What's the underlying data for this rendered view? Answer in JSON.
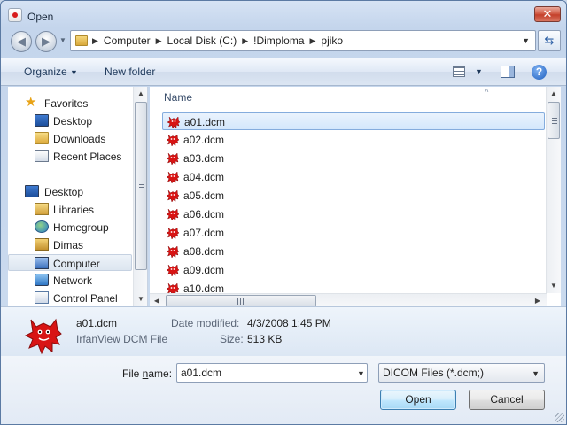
{
  "window": {
    "title": "Open",
    "close_glyph": "✕",
    "accent": "#3c7fb1",
    "title_text_color": "#1b2a3d"
  },
  "address": {
    "back_icon": "back-arrow-icon",
    "forward_icon": "forward-arrow-icon",
    "crumbs": [
      "Computer",
      "Local Disk (C:)",
      "!Dimploma",
      "pjiko"
    ],
    "refresh_icon": "refresh-icon"
  },
  "toolbar": {
    "organize_label": "Organize",
    "new_folder_label": "New folder"
  },
  "nav": {
    "favorites": "Favorites",
    "items": [
      {
        "label": "Desktop",
        "icon": "desktop-icon"
      },
      {
        "label": "Downloads",
        "icon": "downloads-folder-icon"
      },
      {
        "label": "Recent Places",
        "icon": "recent-places-icon"
      }
    ],
    "desktop_root": "Desktop",
    "tree": [
      {
        "label": "Libraries",
        "icon": "libraries-icon"
      },
      {
        "label": "Homegroup",
        "icon": "homegroup-icon"
      },
      {
        "label": "Dimas",
        "icon": "user-folder-icon"
      },
      {
        "label": "Computer",
        "icon": "computer-icon",
        "selected": true
      },
      {
        "label": "Network",
        "icon": "network-icon"
      },
      {
        "label": "Control Panel",
        "icon": "control-panel-icon"
      }
    ]
  },
  "files": {
    "column_name": "Name",
    "items": [
      "a01.dcm",
      "a02.dcm",
      "a03.dcm",
      "a04.dcm",
      "a05.dcm",
      "a06.dcm",
      "a07.dcm",
      "a08.dcm",
      "a09.dcm",
      "a10.dcm"
    ],
    "selected_index": 0,
    "icon": "irfanview-cat-icon"
  },
  "details": {
    "name": "a01.dcm",
    "type": "IrfanView DCM File",
    "date_label": "Date modified:",
    "date_value": "4/3/2008 1:45 PM",
    "size_label": "Size:",
    "size_value": "513 KB"
  },
  "bottom": {
    "file_name_label_pre": "File ",
    "file_name_label_u": "n",
    "file_name_label_post": "ame:",
    "file_name_value": "a01.dcm",
    "filter_value": "DICOM Files (*.dcm;)",
    "open_label": "Open",
    "cancel_label": "Cancel"
  }
}
